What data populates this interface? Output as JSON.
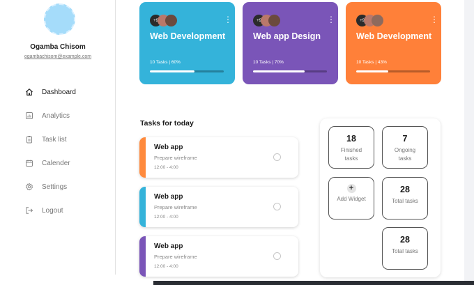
{
  "user": {
    "name": "Ogamba Chisom",
    "email": "ogambachisom@example.com"
  },
  "nav": [
    {
      "label": "Dashboard",
      "icon": "home-icon",
      "active": true
    },
    {
      "label": "Analytics",
      "icon": "chart-icon",
      "active": false
    },
    {
      "label": "Task list",
      "icon": "clipboard-icon",
      "active": false
    },
    {
      "label": "Calender",
      "icon": "calendar-icon",
      "active": false
    },
    {
      "label": "Settings",
      "icon": "gear-icon",
      "active": false
    },
    {
      "label": "Logout",
      "icon": "logout-icon",
      "active": false
    }
  ],
  "projects": [
    {
      "avatar_count": "+9",
      "title": "Web Development",
      "meta": "10 Tasks | 60%",
      "progress": 0.6,
      "color": "#34b3da"
    },
    {
      "avatar_count": "+9",
      "title": "Web app Design",
      "meta": "10 Tasks | 70%",
      "progress": 0.7,
      "color": "#7a55b8"
    },
    {
      "avatar_count": "+9",
      "title": "Web Development",
      "meta": "10 Tasks | 43%",
      "progress": 0.43,
      "color": "#ff8039"
    }
  ],
  "tasks_section": {
    "title": "Tasks for today"
  },
  "tasks": [
    {
      "name": "Web app",
      "description": "Prepare wireframe",
      "time": "12:00 - 4:00",
      "color": "#ff8a3d"
    },
    {
      "name": "Web app",
      "description": "Prepare wireframe",
      "time": "12:00 - 4:00",
      "color": "#34b3da"
    },
    {
      "name": "Web app",
      "description": "Prepare wireframe",
      "time": "12:00 - 4:00",
      "color": "#7a55b8"
    }
  ],
  "stats": {
    "finished": {
      "value": "18",
      "label": "Finished tasks"
    },
    "ongoing": {
      "value": "7",
      "label": "Ongoing tasks"
    },
    "add_widget": {
      "icon": "+",
      "label": "Add Widget"
    },
    "total_1": {
      "value": "28",
      "label": "Total tasks"
    },
    "total_2": {
      "value": "28",
      "label": "Total tasks"
    }
  },
  "colors": {
    "face_1": "#b9786a",
    "face_2": "#6b4a3e",
    "face_3": "#8e6a5d"
  }
}
